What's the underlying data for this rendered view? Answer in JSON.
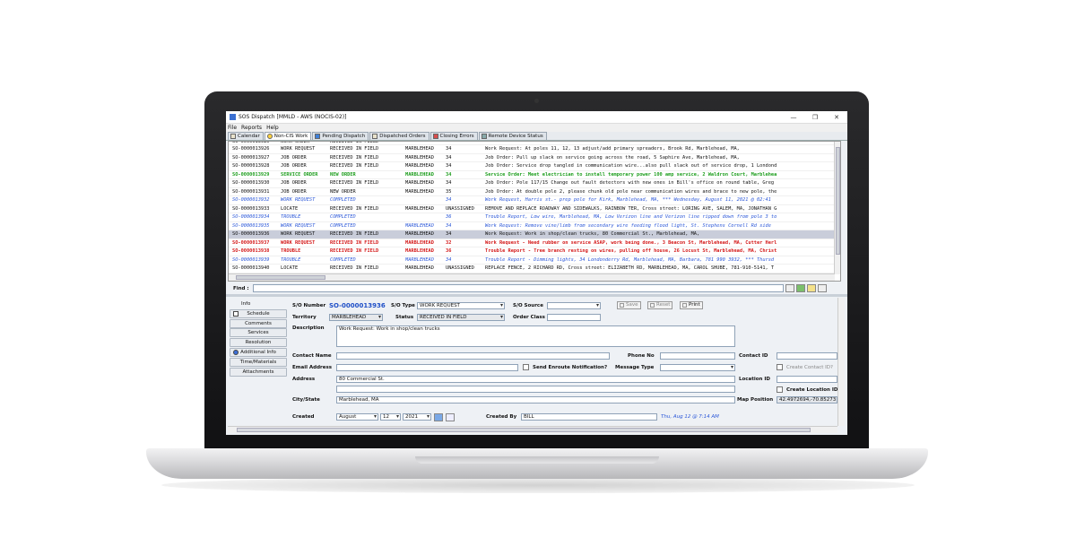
{
  "window": {
    "title": "SOS Dispatch  [MMLD - AWS (NOCIS-02)]"
  },
  "menu": [
    "File",
    "Reports",
    "Help"
  ],
  "tabs": [
    "Calendar",
    "Non-CIS Work",
    "Pending Dispatch",
    "Dispatched Orders",
    "Closing Errors",
    "Remote Device Status"
  ],
  "orders": {
    "rows": [
      {
        "so": "SO-0000013926",
        "type": "WORK REQUEST",
        "status": "RECEIVED IN FIELD",
        "town": "MARBLEHEAD",
        "num": "34",
        "desc": "Work Request: At poles 11, 12, 13 adjust/add primary spreaders, Brook Rd, Marblehead, MA,"
      },
      {
        "so": "SO-0000013927",
        "type": "JOB ORDER",
        "status": "RECEIVED IN FIELD",
        "town": "MARBLEHEAD",
        "num": "34",
        "desc": "Job Order: Pull up slack on service going across the road, 5 Saphire Ave, Marblehead, MA,"
      },
      {
        "so": "SO-0000013928",
        "type": "JOB ORDER",
        "status": "RECEIVED IN FIELD",
        "town": "MARBLEHEAD",
        "num": "34",
        "desc": "Job Order: Service drop tangled in communication wire...also pull slack out of service drop, 1 Londond"
      },
      {
        "so": "SO-0000013929",
        "type": "SERVICE ORDER",
        "status": "NEW ORDER",
        "town": "MARBLEHEAD",
        "num": "34",
        "desc": "Service Order: Meet electrician to install temporary power 100 amp service, 2 Waldron Court, Marblehea"
      },
      {
        "so": "SO-0000013930",
        "type": "JOB ORDER",
        "status": "RECEIVED IN FIELD",
        "town": "MARBLEHEAD",
        "num": "34",
        "desc": "Job Order:  Pole 117/15 Change out fault detectors with new ones in Bill's office on round table, Greg"
      },
      {
        "so": "SO-0000013931",
        "type": "JOB ORDER",
        "status": "NEW ORDER",
        "town": "MARBLEHEAD",
        "num": "35",
        "desc": "Job Order: At double pole 2, please chunk old pole near communication wires and brace to new pole, the"
      },
      {
        "so": "SO-0000013932",
        "type": "WORK REQUEST",
        "status": "COMPLETED",
        "town": "",
        "num": "34",
        "desc": "Work Request, Harris st.- prep pole for Kirk, Marblehead, MA, ***  Wednesday, August 11, 2021  @ 02:41"
      },
      {
        "so": "SO-0000013933",
        "type": "LOCATE",
        "status": "RECEIVED IN FIELD",
        "town": "MARBLEHEAD",
        "num": "UNASSIGNED",
        "desc": "REMOVE AND REPLACE ROADWAY AND SIDEWALKS, RAINBOW TER, Cross street: LORING AVE, SALEM, MA, JONATHAN G"
      },
      {
        "so": "SO-0000013934",
        "type": "TROUBLE",
        "status": "COMPLETED",
        "town": "",
        "num": "36",
        "desc": "Trouble Report, Low wire, Marblehead, MA, Low Verizon line and Verizon line ripped down from pole 3 to"
      },
      {
        "so": "SO-0000013935",
        "type": "WORK REQUEST",
        "status": "COMPLETED",
        "town": "MARBLEHEAD",
        "num": "34",
        "desc": "Work Request: Remove vine/limb from secondary wire feeding flood light, St. Stephens  Cornell Rd side"
      },
      {
        "so": "SO-0000013936",
        "type": "WORK REQUEST",
        "status": "RECEIVED IN FIELD",
        "town": "MARBLEHEAD",
        "num": "34",
        "desc": "Work Request: Work in shop/clean trucks, 80 Commercial St., Marblehead, MA,"
      },
      {
        "so": "SO-0000013937",
        "type": "WORK REQUEST",
        "status": "RECEIVED IN FIELD",
        "town": "MARBLEHEAD",
        "num": "32",
        "desc": "Work Request - Need rubber on service ASAP, work being done., 3 Beacon St, Marblehead, MA, Cutter Herl"
      },
      {
        "so": "SO-0000013938",
        "type": "TROUBLE",
        "status": "RECEIVED IN FIELD",
        "town": "MARBLEHEAD",
        "num": "36",
        "desc": "Trouble Report - Tree branch resting on wires, pulling off house, 26 Locust St, Marblehead, MA, Christ"
      },
      {
        "so": "SO-0000013939",
        "type": "TROUBLE",
        "status": "COMPLETED",
        "town": "MARBLEHEAD",
        "num": "34",
        "desc": "Trouble Report - Dimming lights, 34 Londonderry Rd, Marblehead, MA, Barbara, 781 990 3932, ***  Thursd"
      },
      {
        "so": "SO-0000013940",
        "type": "LOCATE",
        "status": "RECEIVED IN FIELD",
        "town": "MARBLEHEAD",
        "num": "UNASSIGNED",
        "desc": "REPLACE  FENCE, 2 RICHARD RD, Cross street: ELIZABETH RD, MARBLEHEAD, MA, CAROL SHUBE, 781-910-5141, T"
      }
    ]
  },
  "find": {
    "label": "Find :"
  },
  "nav": [
    "Info",
    "Schedule",
    "Comments",
    "Services",
    "Resolution",
    "Additional Info",
    "Time/Materials",
    "Attachments"
  ],
  "form": {
    "so_number_label": "S/O Number",
    "so_number": "SO-0000013936",
    "so_type_label": "S/O Type",
    "so_type": "WORK REQUEST",
    "so_source_label": "S/O Source",
    "so_source": "",
    "save_label": "Save",
    "reset_label": "Reset",
    "print_label": "Print",
    "territory_label": "Territory",
    "territory": "MARBLEHEAD",
    "status_label": "Status",
    "status": "RECEIVED IN FIELD",
    "order_class_label": "Order Class",
    "order_class": "",
    "description_label": "Description",
    "description": "Work Request: Work in shop/clean trucks",
    "contact_name_label": "Contact Name",
    "contact_name": "",
    "phone_label": "Phone No",
    "phone": "",
    "contact_id_label": "Contact ID",
    "contact_id": "",
    "email_label": "Email Address",
    "email": "",
    "enroute_label": "Send Enroute Notification?",
    "message_type_label": "Message Type",
    "message_type": "",
    "create_contact_label": "Create Contact ID?",
    "address_label": "Address",
    "address": "80 Commercial St.",
    "address2": "",
    "location_id_label": "Location ID",
    "location_id": "",
    "create_location_label": "Create Location ID?",
    "city_state_label": "City/State",
    "city_state": "Marblehead, MA",
    "map_position_label": "Map Position",
    "map_position": "42.4972694,-70.85273",
    "created_label": "Created",
    "created_month": "August",
    "created_day": "12",
    "created_year": "2021",
    "created_by_label": "Created By",
    "created_by": "BILL",
    "created_at": "Thu, Aug 12 @ 7:14 AM"
  }
}
